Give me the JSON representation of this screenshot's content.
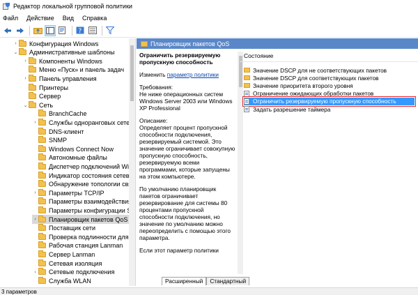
{
  "window": {
    "title": "Редактор локальной групповой политики"
  },
  "menu": [
    "Файл",
    "Действие",
    "Вид",
    "Справка"
  ],
  "toolbar": [
    "back-icon",
    "forward-icon",
    "up-folder-icon",
    "show-tree-icon",
    "export-icon",
    "help-icon",
    "properties-icon",
    "filter-icon"
  ],
  "tree": [
    {
      "label": "Конфигурация Windows",
      "indent": 0,
      "arrow": "›"
    },
    {
      "label": "Административные шаблоны",
      "indent": 0,
      "arrow": "⌄"
    },
    {
      "label": "Компоненты Windows",
      "indent": 1,
      "arrow": "›"
    },
    {
      "label": "Меню «Пуск» и панель задач",
      "indent": 1,
      "arrow": ""
    },
    {
      "label": "Панель управления",
      "indent": 1,
      "arrow": "›"
    },
    {
      "label": "Принтеры",
      "indent": 1,
      "arrow": ""
    },
    {
      "label": "Сервер",
      "indent": 1,
      "arrow": ""
    },
    {
      "label": "Сеть",
      "indent": 1,
      "arrow": "⌄"
    },
    {
      "label": "BranchCache",
      "indent": 2,
      "arrow": ""
    },
    {
      "label": "Службы одноранговых сетей M",
      "indent": 2,
      "arrow": "›"
    },
    {
      "label": "DNS-клиент",
      "indent": 2,
      "arrow": ""
    },
    {
      "label": "SNMP",
      "indent": 2,
      "arrow": ""
    },
    {
      "label": "Windows Connect Now",
      "indent": 2,
      "arrow": ""
    },
    {
      "label": "Автономные файлы",
      "indent": 2,
      "arrow": ""
    },
    {
      "label": "Диспетчер подключений Wind",
      "indent": 2,
      "arrow": ""
    },
    {
      "label": "Индикатор состояния сетевого",
      "indent": 2,
      "arrow": ""
    },
    {
      "label": "Обнаружение топологии связи",
      "indent": 2,
      "arrow": ""
    },
    {
      "label": "Параметры TCP/IP",
      "indent": 2,
      "arrow": "›"
    },
    {
      "label": "Параметры взаимодействия к",
      "indent": 2,
      "arrow": ""
    },
    {
      "label": "Параметры конфигурации SSL",
      "indent": 2,
      "arrow": ""
    },
    {
      "label": "Планировщик пакетов QoS",
      "indent": 2,
      "arrow": "›",
      "selected": true
    },
    {
      "label": "Поставщик сети",
      "indent": 2,
      "arrow": ""
    },
    {
      "label": "Проверка подлинности для тер",
      "indent": 2,
      "arrow": ""
    },
    {
      "label": "Рабочая станция Lanman",
      "indent": 2,
      "arrow": ""
    },
    {
      "label": "Сервер Lanman",
      "indent": 2,
      "arrow": ""
    },
    {
      "label": "Сетевая изоляция",
      "indent": 2,
      "arrow": ""
    },
    {
      "label": "Сетевые подключения",
      "indent": 2,
      "arrow": "›"
    },
    {
      "label": "Служба WLAN",
      "indent": 2,
      "arrow": ""
    }
  ],
  "right": {
    "header": "Планировщик пакетов QoS",
    "description": {
      "title": "Ограничить резервируемую пропускную способность",
      "link_prefix": "Изменить ",
      "link": "параметр политики",
      "requirements_label": "Требования:",
      "requirements": "Не ниже операционных систем Windows Server 2003 или Windows XP Professional",
      "description_label": "Описание:",
      "description": "Определяет процент пропускной способности подключения, резервируемый системой. Это значение ограничивает совокупную пропускную способность, резервируемую всеми программами, которые запущены на этом компьютере.",
      "p2": "По умолчанию планировщик пакетов ограничивает резервирование для системы 80 процентами пропускной способности подключения, но значение по умолчанию можно переопределить с помощью этого параметра.",
      "p3": "Если этот параметр политики"
    },
    "list_header": "Состояние",
    "items": [
      {
        "label": "Значение DSCP для не соответствующих пакетов",
        "type": "folder"
      },
      {
        "label": "Значение DSCP для соответствующих пакетов",
        "type": "folder"
      },
      {
        "label": "Значение приоритета второго уровня",
        "type": "folder"
      },
      {
        "label": "Ограничение ожидающих обработки пакетов",
        "type": "setting"
      },
      {
        "label": "Ограничить резервируемую пропускную способность",
        "type": "setting",
        "selected": true
      },
      {
        "label": "Задать разрешение таймера",
        "type": "setting"
      }
    ],
    "tabs": [
      "Расширенный",
      "Стандартный"
    ]
  },
  "status": "3 параметров"
}
